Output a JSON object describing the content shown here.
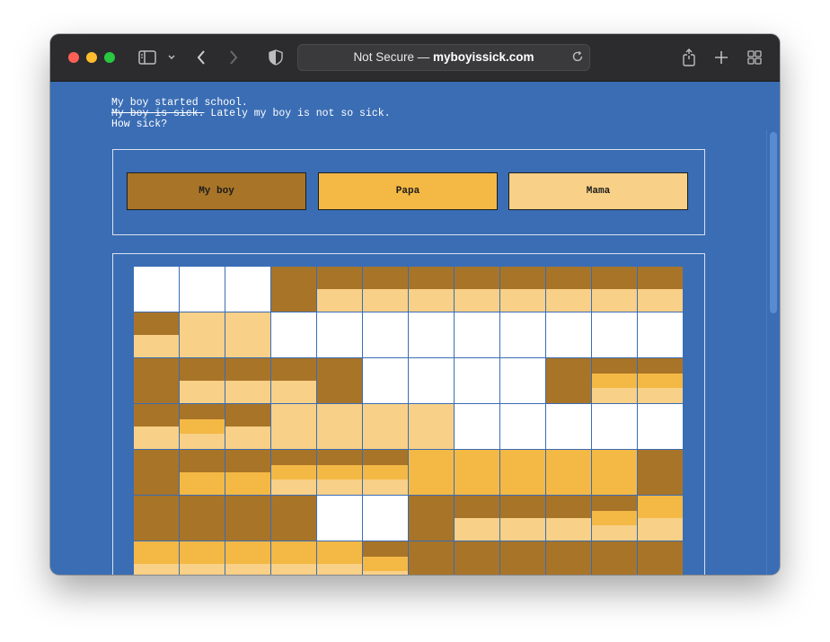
{
  "browser": {
    "address_prefix": "Not Secure — ",
    "address_domain": "myboyissick.com"
  },
  "intro": {
    "line1": "My boy started school.",
    "line2_struck": "My boy is sick.",
    "line2_rest": " Lately my boy is not so sick.",
    "line3": "How sick?"
  },
  "legend": [
    {
      "label": "My boy",
      "color": "#a87428"
    },
    {
      "label": "Papa",
      "color": "#f4b845"
    },
    {
      "label": "Mama",
      "color": "#f8d087"
    }
  ],
  "colors": {
    "B": "#a87428",
    "P": "#f4b845",
    "M": "#f8d087",
    "W": "#ffffff"
  },
  "grid": [
    [
      "W",
      "W",
      "W",
      "B",
      "BM",
      "BM",
      "BM",
      "BM",
      "BM",
      "BM",
      "BM",
      "BM"
    ],
    [
      "BM",
      "M",
      "M",
      "W",
      "W",
      "W",
      "W",
      "W",
      "W",
      "W",
      "W",
      "W"
    ],
    [
      "B",
      "BM",
      "BM",
      "BM",
      "B",
      "W",
      "W",
      "W",
      "W",
      "B",
      "BPM",
      "BPM"
    ],
    [
      "BM",
      "BPM",
      "BM",
      "M",
      "M",
      "M",
      "M",
      "W",
      "W",
      "W",
      "W",
      "W"
    ],
    [
      "B",
      "BP",
      "BP",
      "BPM",
      "BPM",
      "BPM",
      "P",
      "P",
      "P",
      "P",
      "P",
      "B"
    ],
    [
      "B",
      "B",
      "B",
      "B",
      "W",
      "W",
      "B",
      "BM",
      "BM",
      "BM",
      "BPM",
      "PM"
    ],
    [
      "PM",
      "PM",
      "PM",
      "PM",
      "PM",
      "BPM",
      "B",
      "B",
      "B",
      "B",
      "B",
      "B"
    ]
  ]
}
